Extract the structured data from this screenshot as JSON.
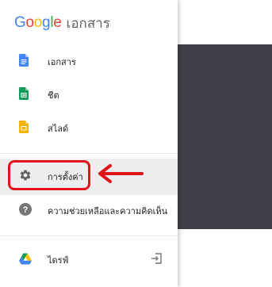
{
  "app": {
    "logo_text": "Google",
    "logo_letters": [
      "G",
      "o",
      "o",
      "g",
      "l",
      "e"
    ],
    "logo_colors": [
      "#4285F4",
      "#EA4335",
      "#FBBC05",
      "#4285F4",
      "#34A853",
      "#EA4335"
    ],
    "product_name": "เอกสาร"
  },
  "nav": {
    "docs": {
      "label": "เอกสาร",
      "icon": "docs-icon",
      "color": "#4285F4"
    },
    "sheets": {
      "label": "ชีต",
      "icon": "sheets-icon",
      "color": "#0F9D58"
    },
    "slides": {
      "label": "สไลด์",
      "icon": "slides-icon",
      "color": "#F4B400"
    },
    "settings": {
      "label": "การตั้งค่า",
      "icon": "gear-icon",
      "highlighted": true
    },
    "help": {
      "label": "ความช่วยเหลือและความคิดเห็น",
      "icon": "help-icon"
    },
    "drive": {
      "label": "ไดรฟ์",
      "icon": "drive-icon",
      "action_icon": "open-in-new-icon"
    }
  },
  "annotation": {
    "color": "#E0131B",
    "shape": "rounded-rectangle",
    "arrow_direction": "left"
  }
}
